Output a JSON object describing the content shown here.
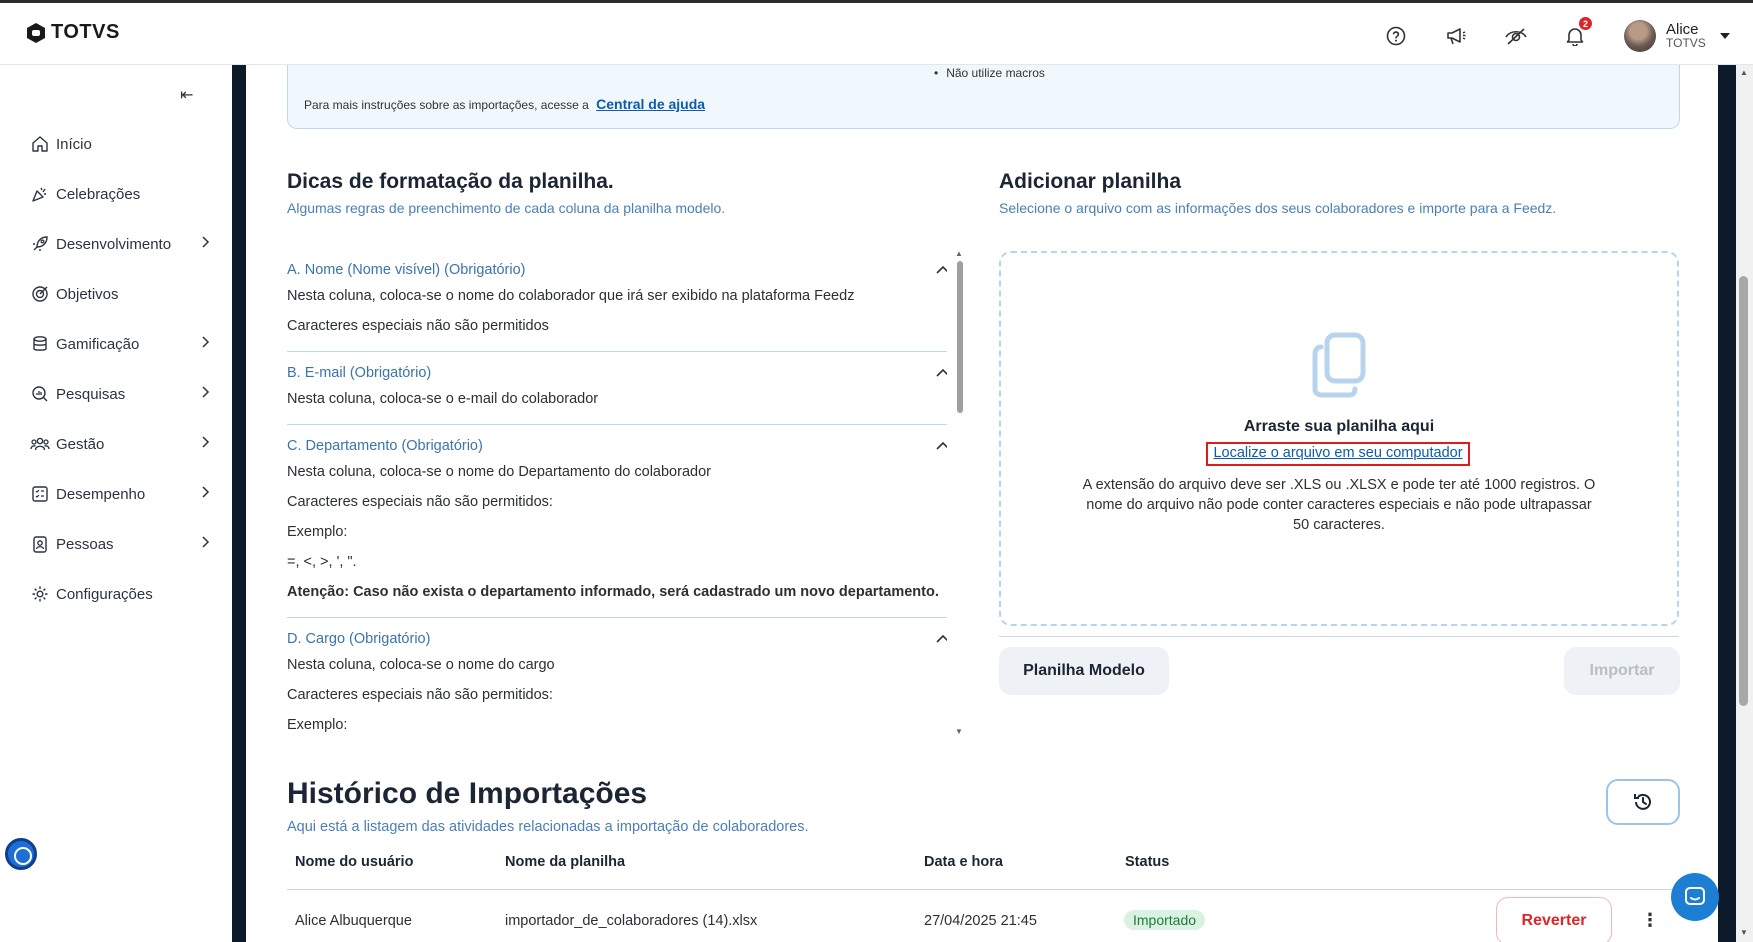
{
  "header": {
    "logo_text": "TOTVS",
    "notification_count": "2",
    "user_name": "Alice",
    "user_org": "TOTVS"
  },
  "sidebar": {
    "items": [
      {
        "label": "Início",
        "icon": "home-icon",
        "chevron": false
      },
      {
        "label": "Celebrações",
        "icon": "party-icon",
        "chevron": false
      },
      {
        "label": "Desenvolvimento",
        "icon": "rocket-icon",
        "chevron": true
      },
      {
        "label": "Objetivos",
        "icon": "target-icon",
        "chevron": false
      },
      {
        "label": "Gamificação",
        "icon": "coins-icon",
        "chevron": true
      },
      {
        "label": "Pesquisas",
        "icon": "survey-icon",
        "chevron": true
      },
      {
        "label": "Gestão",
        "icon": "team-icon",
        "chevron": true
      },
      {
        "label": "Desempenho",
        "icon": "checklist-icon",
        "chevron": true
      },
      {
        "label": "Pessoas",
        "icon": "badge-icon",
        "chevron": true
      },
      {
        "label": "Configurações",
        "icon": "gear-icon",
        "chevron": false
      }
    ]
  },
  "info": {
    "bullet": "Não utilize macros",
    "instructions": "Para mais instruções sobre as importações, acesse a",
    "help_link": "Central de ajuda"
  },
  "tips": {
    "title": "Dicas de formatação da planilha.",
    "subtitle": "Algumas regras de preenchimento de cada coluna da planilha modelo.",
    "items": [
      {
        "head": "A. Nome (Nome visível) (Obrigatório)",
        "lines": [
          "Nesta coluna, coloca-se o nome do colaborador que irá ser exibido na plataforma Feedz",
          "Caracteres especiais não são permitidos"
        ]
      },
      {
        "head": "B. E-mail (Obrigatório)",
        "lines": [
          "Nesta coluna, coloca-se o e-mail do colaborador"
        ]
      },
      {
        "head": "C. Departamento (Obrigatório)",
        "lines": [
          "Nesta coluna, coloca-se o nome do Departamento do colaborador",
          "Caracteres especiais não são permitidos:",
          "Exemplo:",
          "=, <, >, ', \"."
        ],
        "bold": "Atenção: Caso não exista o departamento informado, será cadastrado um novo departamento."
      },
      {
        "head": "D. Cargo (Obrigatório)",
        "lines": [
          "Nesta coluna, coloca-se o nome do cargo",
          "Caracteres especiais não são permitidos:",
          "Exemplo:"
        ]
      }
    ]
  },
  "upload": {
    "title": "Adicionar planilha",
    "subtitle": "Selecione o arquivo com as informações dos seus colaboradores e importe para a Feedz.",
    "drop_title": "Arraste sua planilha aqui",
    "drop_link": "Localize o arquivo em seu computador",
    "drop_desc": "A extensão do arquivo deve ser .XLS ou .XLSX e pode ter até 1000 registros. O nome do arquivo não pode conter caracteres especiais e não pode ultrapassar 50 caracteres.",
    "model_button": "Planilha Modelo",
    "import_button": "Importar"
  },
  "history": {
    "title": "Histórico de Importações",
    "subtitle": "Aqui está a listagem das atividades relacionadas a importação de colaboradores.",
    "columns": [
      "Nome do usuário",
      "Nome da planilha",
      "Data e hora",
      "Status"
    ],
    "rows": [
      {
        "user": "Alice Albuquerque",
        "file": "importador_de_colaboradores (14).xlsx",
        "datetime": "27/04/2025 21:45",
        "status": "Importado",
        "action": "Reverter"
      }
    ]
  },
  "colors": {
    "accent": "#0b5cab",
    "link_blue": "#4a7fb5",
    "danger": "#d9262b",
    "success_bg": "#d9f2e2"
  }
}
